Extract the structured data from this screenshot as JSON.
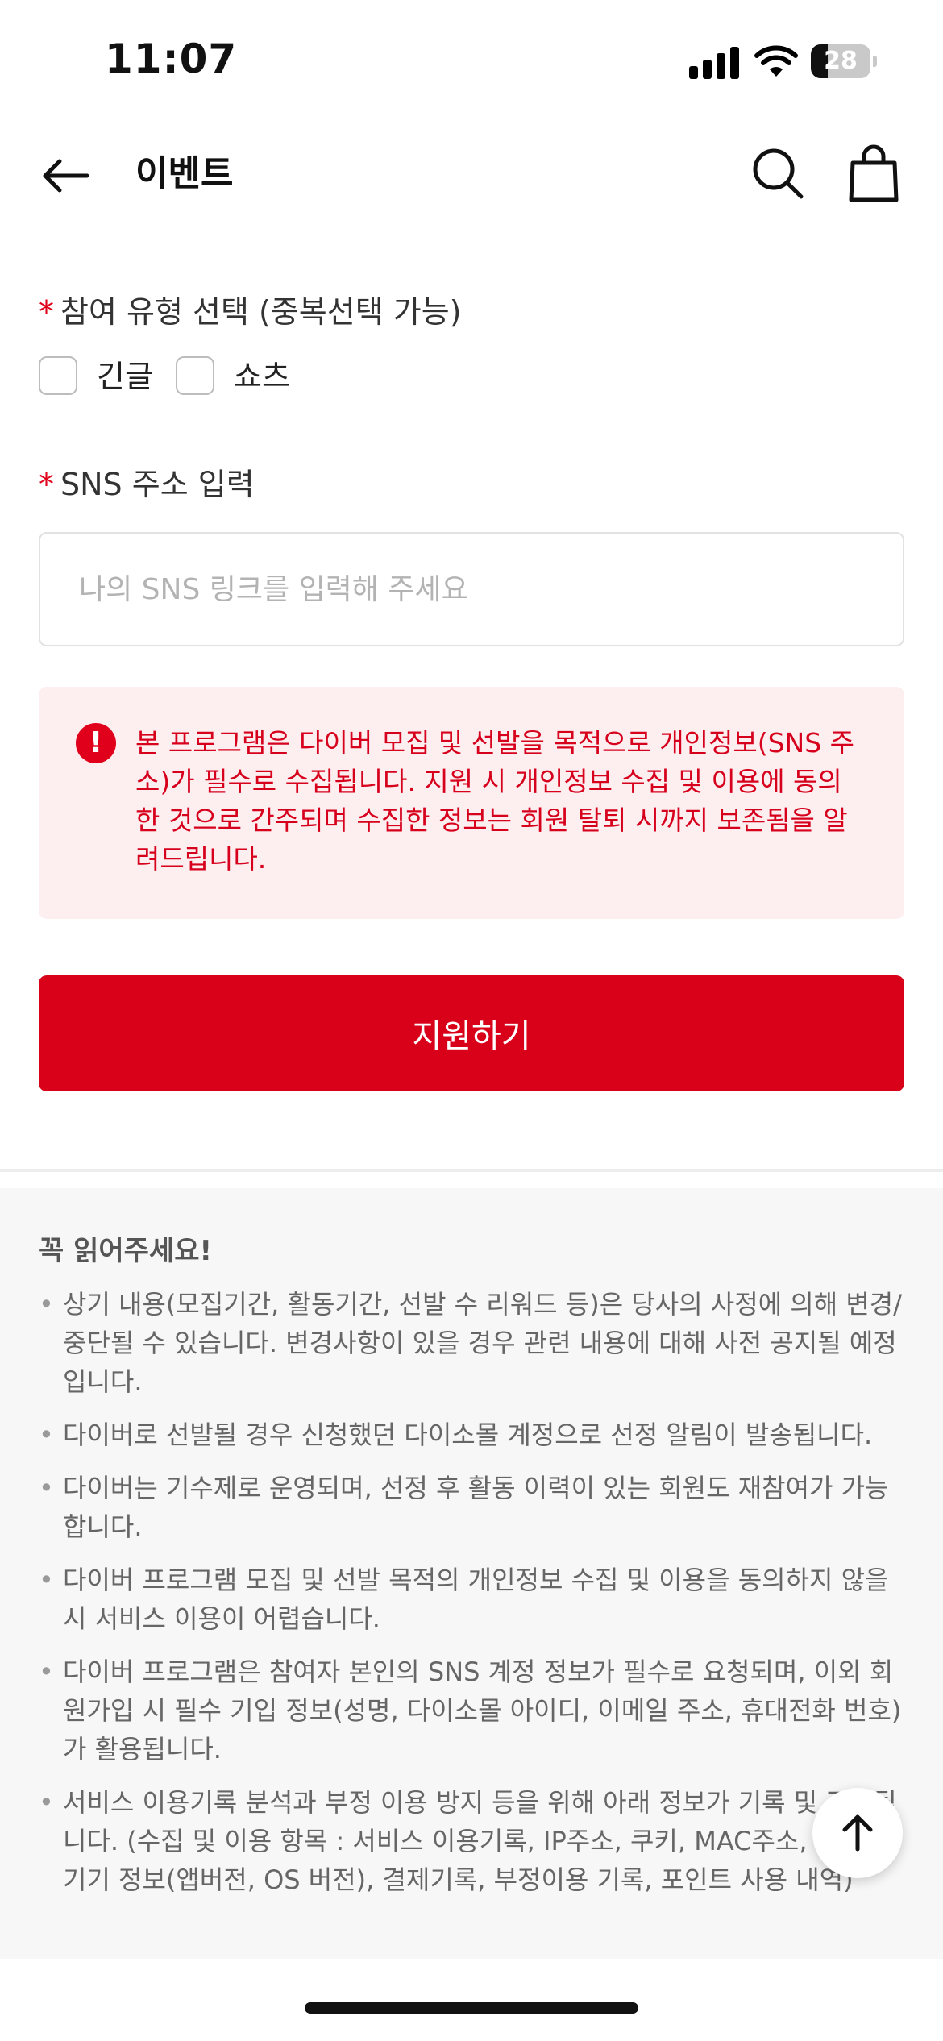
{
  "status_bar": {
    "time": "11:07",
    "battery": 28
  },
  "header": {
    "title": "이벤트",
    "back_icon": "arrow-left-icon",
    "search_icon": "search-icon",
    "bag_icon": "shopping-bag-icon"
  },
  "form": {
    "participation": {
      "required_mark": "*",
      "label": "참여 유형 선택 (중복선택 가능)",
      "options": [
        {
          "label": "긴글",
          "checked": false
        },
        {
          "label": "쇼츠",
          "checked": false
        }
      ]
    },
    "sns": {
      "required_mark": "*",
      "label": "SNS 주소 입력",
      "value": "",
      "placeholder": "나의 SNS 링크를 입력해 주세요"
    },
    "notice": {
      "icon": "exclamation-icon",
      "text": "본 프로그램은 다이버 모집 및 선발을 목적으로 개인정보(SNS 주소)가 필수로 수집됩니다. 지원 시 개인정보 수집 및 이용에 동의한 것으로 간주되며 수집한 정보는 회원 탈퇴 시까지 보존됨을 알려드립니다."
    },
    "apply_label": "지원하기"
  },
  "info": {
    "title": "꼭 읽어주세요!",
    "items": [
      "상기 내용(모집기간, 활동기간, 선발 수 리워드 등)은 당사의 사정에 의해 변경/중단될 수 있습니다. 변경사항이 있을 경우 관련 내용에 대해 사전 공지될 예정입니다.",
      "다이버로 선발될 경우 신청했던 다이소몰 계정으로 선정 알림이 발송됩니다.",
      "다이버는 기수제로 운영되며, 선정 후 활동 이력이 있는 회원도 재참여가 가능합니다.",
      "다이버 프로그램 모집 및 선발 목적의 개인정보 수집 및 이용을 동의하지 않을 시 서비스 이용이 어렵습니다.",
      "다이버 프로그램은 참여자 본인의 SNS 계정 정보가 필수로 요청되며, 이외 회원가입 시 필수 기입 정보(성명, 다이소몰 아이디, 이메일 주소, 휴대전화 번호)가 활용됩니다.",
      "서비스 이용기록 분석과 부정 이용 방지 등을 위해 아래 정보가 기록 및 관리됩니다. (수집 및 이용 항목 : 서비스 이용기록, IP주소, 쿠키, MAC주소, 모바일 기기 정보(앱버전, OS 버전), 결제기록, 부정이용 기록, 포인트 사용 내역)"
    ]
  },
  "scroll_top_icon": "arrow-up-icon",
  "colors": {
    "accent": "#d90019",
    "notice_bg": "#fdeef0",
    "notice_text": "#d6001c"
  }
}
